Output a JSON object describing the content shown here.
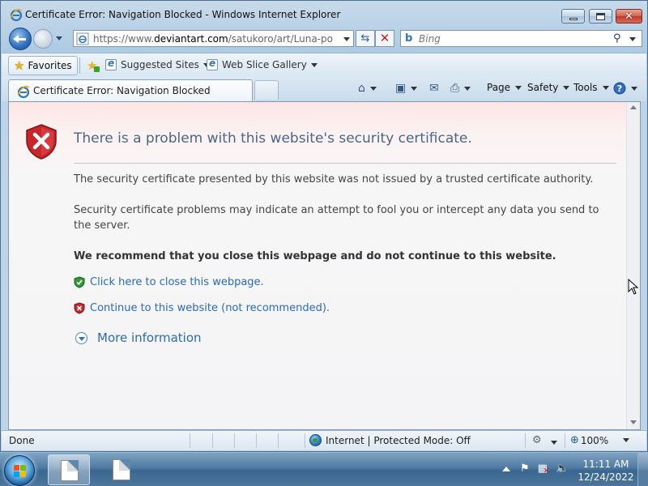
{
  "window": {
    "title": "Certificate Error: Navigation Blocked - Windows Internet Explorer",
    "icon": "ie-icon"
  },
  "nav": {
    "address_prefix": "https://www.",
    "address_domain": "deviantart.com",
    "address_path": "/satukoro/art/Luna-port-to-'",
    "search_placeholder": "Bing"
  },
  "favorites_bar": {
    "favorites_label": "Favorites",
    "links": [
      {
        "label": "Suggested Sites"
      },
      {
        "label": "Web Slice Gallery"
      }
    ]
  },
  "tabs": [
    {
      "label": "Certificate Error: Navigation Blocked"
    }
  ],
  "command_bar": {
    "page_label": "Page",
    "safety_label": "Safety",
    "tools_label": "Tools"
  },
  "content": {
    "heading": "There is a problem with this website's security certificate.",
    "paragraph1": "The security certificate presented by this website was not issued by a trusted certificate authority.",
    "paragraph2": "Security certificate problems may indicate an attempt to fool you or intercept any data you send to the server.",
    "recommendation": "We recommend that you close this webpage and do not continue to this website.",
    "close_link": "Click here to close this webpage.",
    "continue_link": "Continue to this website (not recommended).",
    "more_info": "More information"
  },
  "statusbar": {
    "status": "Done",
    "zone": "Internet | Protected Mode: Off",
    "zoom": "100%"
  },
  "taskbar": {
    "time": "11:11 AM",
    "date": "12/24/2022"
  },
  "colors": {
    "heading": "#4c6685",
    "link": "#2a6bb3",
    "shield_red": "#c8262b",
    "shield_green": "#2e9a34"
  }
}
